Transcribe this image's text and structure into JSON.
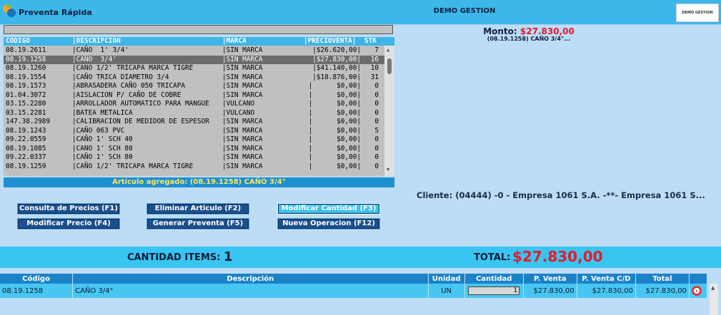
{
  "header": {
    "app_title": "Preventa Rápida",
    "company_title": "DEMO GESTION",
    "brand_label": "DEMO GESTION"
  },
  "product_grid": {
    "columns": [
      "CODIGO",
      "|DESCRIPCION",
      "|MARCA",
      "|PRECIOVENTA|",
      "STK"
    ],
    "rows": [
      {
        "code": "08.19.2611",
        "desc": "|CAÑO  1' 3/4'",
        "marca": "|SIN MARCA",
        "precio": "|$26.620,00|",
        "stk": "7"
      },
      {
        "code": "08.19.1258",
        "desc": "|CAÑO  3/4'",
        "marca": "|SIN MARCA",
        "precio": "|$27.830,00|",
        "stk": "16"
      },
      {
        "code": "08.19.1260",
        "desc": "|CANO 1/2' TRICAPA MARCA TIGRE",
        "marca": "|SIN MARCA",
        "precio": "|$41.140,00|",
        "stk": "10"
      },
      {
        "code": "08.19.1554",
        "desc": "|CAÑO TRICA DIAMETRO 3/4",
        "marca": "|SIN MARCA",
        "precio": "|$18.876,00|",
        "stk": "31"
      },
      {
        "code": "08.19.1573",
        "desc": "|ABRASADERA CAÑO 050 TRICAPA",
        "marca": "|SIN MARCA",
        "precio": "|      $0,00|",
        "stk": "0"
      },
      {
        "code": "01.04.3072",
        "desc": "|AISLACION P/ CAÑO DE COBRE",
        "marca": "|SIN MARCA",
        "precio": "|      $0,00|",
        "stk": "0"
      },
      {
        "code": "03.15.2280",
        "desc": "|ARROLLADOR AUTOMATICO PARA MANGUE",
        "marca": "|VULCANO",
        "precio": "|      $0,00|",
        "stk": "0"
      },
      {
        "code": "03.15.2281",
        "desc": "|BATEA METALICA",
        "marca": "|VULCANO",
        "precio": "|      $0,00|",
        "stk": "0"
      },
      {
        "code": "147.38.2989",
        "desc": "|CALIBRACION DE MEDIDOR DE ESPESOR",
        "marca": "|SIN MARCA",
        "precio": "|      $0,00|",
        "stk": "0"
      },
      {
        "code": "08.19.1243",
        "desc": "|CAÑO 063 PVC",
        "marca": "|SIN MARCA",
        "precio": "|      $0,00|",
        "stk": "5"
      },
      {
        "code": "09.22.0559",
        "desc": "|CAÑO 1' SCH 40",
        "marca": "|SIN MARCA",
        "precio": "|      $0,00|",
        "stk": "0"
      },
      {
        "code": "08.19.1085",
        "desc": "|CANO 1' SCH 80",
        "marca": "|SIN MARCA",
        "precio": "|      $0,00|",
        "stk": "0"
      },
      {
        "code": "09.22.0337",
        "desc": "|CAÑO 1' SCH 80",
        "marca": "|SIN MARCA",
        "precio": "|      $0,00|",
        "stk": "0"
      },
      {
        "code": "08.19.1259",
        "desc": "|CAÑO 1/2' TRICAPA MARCA TIGRE",
        "marca": "|SIN MARCA",
        "precio": "|      $0,00|",
        "stk": "0"
      }
    ],
    "selected_row": 1,
    "status_message": "Artículo agregado: (08.19.1258) CAÑO 3/4\""
  },
  "summary": {
    "monto_label": "Monto:",
    "monto_value": "$27.830,00",
    "monto_item": "(08.19.1258) CAÑO 3/4\"...",
    "cliente": "Cliente: (04444) -0 - Empresa 1061 S.A. -**- Empresa 1061 S..."
  },
  "buttons": {
    "consulta_precios": "Consulta de Precios (F1)",
    "eliminar_articulo": "Eliminar Articulo (F2)",
    "modificar_cantidad": "Modificar Cantidad (F3)",
    "modificar_precio": "Modificar Precio (F4)",
    "generar_preventa": "Generar Preventa (F5)",
    "nueva_operacion": "Nueva Operacion (F12)"
  },
  "totals": {
    "cantidad_items_label": "CANTIDAD ITEMS:",
    "cantidad_items_value": "1",
    "total_label": "TOTAL:",
    "total_value": "$27.830,00"
  },
  "items_table": {
    "headers": {
      "codigo": "Código",
      "descripcion": "Descripción",
      "unidad": "Unidad",
      "cantidad": "Cantidad",
      "pventa": "P. Venta",
      "pventa_cd": "P. Venta C/D",
      "total": "Total"
    },
    "rows": [
      {
        "codigo": "08.19.1258",
        "descripcion": "CAÑO 3/4\"",
        "unidad": "UN",
        "cantidad": "1",
        "pventa": "$27.830,00",
        "pventa_cd": "$27.830,00",
        "total": "$27.830,00"
      }
    ]
  },
  "colors": {
    "accent": "#3db7ea",
    "total_red": "#e8192c",
    "button_blue": "#1c4f8c"
  }
}
